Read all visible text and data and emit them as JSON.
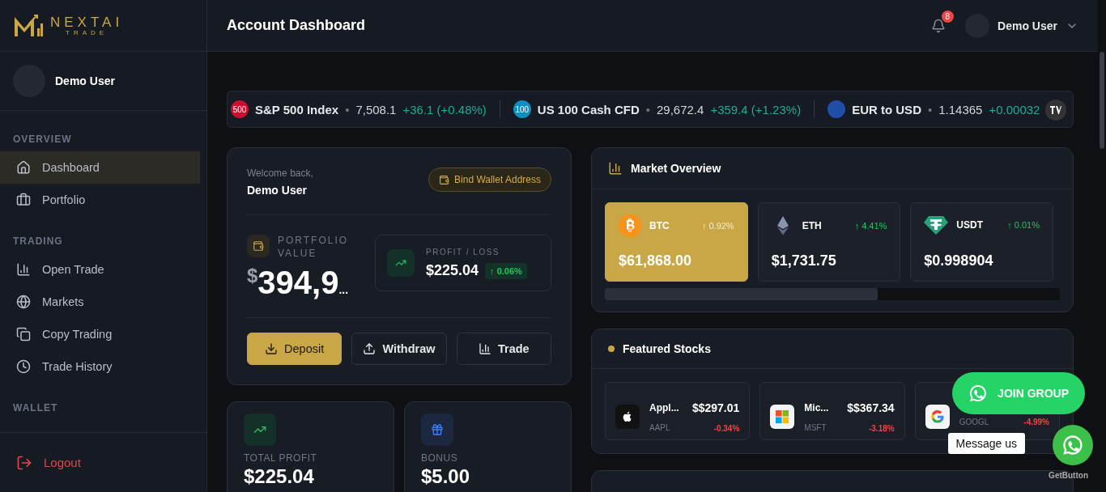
{
  "brand": {
    "name": "NEXTAI",
    "tagline": "TRADE"
  },
  "sidebar": {
    "user": "Demo User",
    "sections": [
      {
        "title": "OVERVIEW",
        "items": [
          {
            "label": "Dashboard",
            "selected": true
          },
          {
            "label": "Portfolio",
            "selected": false
          }
        ]
      },
      {
        "title": "TRADING",
        "items": [
          {
            "label": "Open Trade",
            "selected": false
          },
          {
            "label": "Markets",
            "selected": false
          },
          {
            "label": "Copy Trading",
            "selected": false
          },
          {
            "label": "Trade History",
            "selected": false
          }
        ]
      },
      {
        "title": "WALLET"
      }
    ],
    "logout": "Logout"
  },
  "header": {
    "title": "Account Dashboard",
    "notifications": "8",
    "user": "Demo User"
  },
  "ticker": [
    {
      "badge": "500",
      "color": "#c8102e",
      "name": "S&P 500 Index",
      "separator": "•",
      "price": "7,508.1",
      "change": "+36.1 (+0.48%)"
    },
    {
      "badge": "100",
      "color": "#0f8fbf",
      "name": "US 100 Cash CFD",
      "separator": "•",
      "price": "29,672.4",
      "change": "+359.4 (+1.23%)"
    },
    {
      "color": "#1f4fa8",
      "name": "EUR to USD",
      "separator": "•",
      "price": "1.14365",
      "change": "+0.00032"
    }
  ],
  "portfolio": {
    "greeting": "Welcome back,",
    "user": "Demo User",
    "bind_button": "Bind Wallet Address",
    "value_label": "PORTFOLIO VALUE",
    "currency": "$",
    "value": "394,9",
    "value_cut": "...",
    "pl_label": "PROFIT / LOSS",
    "pl_value": "$225.04",
    "pl_change": "↑ 0.06%",
    "buttons": [
      {
        "label": "Deposit",
        "kind": "primary"
      },
      {
        "label": "Withdraw",
        "kind": "outline"
      },
      {
        "label": "Trade",
        "kind": "outline"
      }
    ]
  },
  "stats": [
    {
      "label": "TOTAL PROFIT",
      "value": "$225.04"
    },
    {
      "label": "BONUS",
      "value": "$5.00"
    }
  ],
  "market_overview": {
    "title": "Market Overview",
    "coins": [
      {
        "symbol": "BTC",
        "change": "↑ 0.92%",
        "price": "$61,868.00",
        "selected": true
      },
      {
        "symbol": "ETH",
        "change": "↑ 4.41%",
        "price": "$1,731.75",
        "selected": false
      },
      {
        "symbol": "USDT",
        "change": "↑ 0.01%",
        "price": "$0.998904",
        "selected": false
      }
    ]
  },
  "featured_stocks": {
    "title": "Featured Stocks",
    "stocks": [
      {
        "name": "Appl...",
        "ticker": "AAPL",
        "price": "$$297.01",
        "change": "-0.34%"
      },
      {
        "name": "Mic...",
        "ticker": "MSFT",
        "price": "$$367.34",
        "change": "-3.18%"
      },
      {
        "ticker": "GOOGL",
        "change": "-4.99%"
      }
    ]
  },
  "widget": {
    "join_button": "JOIN GROUP",
    "tooltip": "Message us",
    "credit": "GetButton"
  }
}
